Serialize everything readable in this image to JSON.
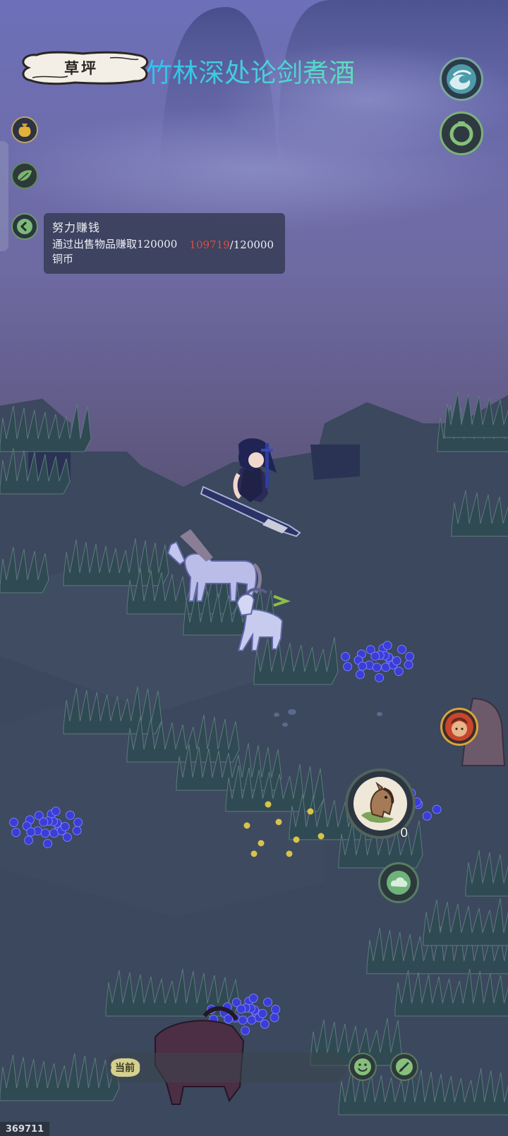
{
  "location": {
    "name": "草坪"
  },
  "caption": "竹林深处论剑煮酒",
  "quest": {
    "title": "努力赚钱",
    "description": "通过出售物品赚取120000铜币",
    "current": "109719",
    "target": "/120000"
  },
  "mount_slot": {
    "count": "0",
    "icon": "horse-head-icon"
  },
  "chat": {
    "channel_label": "当前"
  },
  "score": "369711",
  "icons": {
    "top_right_1": "wave-icon",
    "top_right_2": "gourd-ring-icon",
    "left_1": "money-bag-icon",
    "left_2": "leaf-icon",
    "left_3": "collapse-arrow-icon",
    "right_mid": "warrior-portrait-icon",
    "cloud_button": "cloud-icon",
    "emoji_button": "smile-icon",
    "brush_button": "brush-icon"
  },
  "colors": {
    "sky_top": "#6a6eb0",
    "sky_bottom": "#5a567a",
    "ground": "#3c4a5e",
    "grass": "#2f4a52",
    "flowers": "#3a3dd8",
    "caption": "#35c8e6",
    "quest_progress_current": "#e24b3c"
  }
}
